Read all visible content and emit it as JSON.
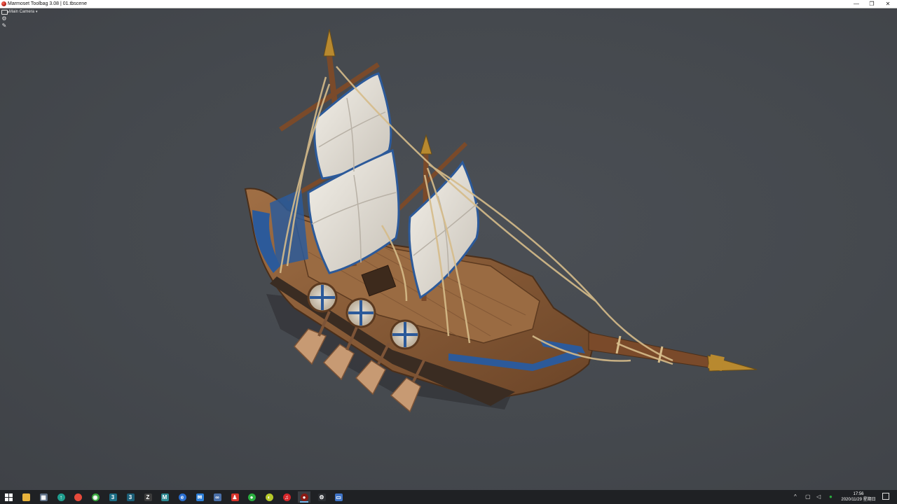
{
  "window": {
    "title": "Marmoset Toolbag 3.08 | 01.tbscene",
    "minimize_glyph": "—",
    "restore_glyph": "❐",
    "close_glyph": "✕"
  },
  "viewport": {
    "camera_label": "Main Camera",
    "camera_caret": "▾",
    "settings_glyph": "⚙",
    "light_glyph": "✎",
    "background_color": "#45494e"
  },
  "taskbar": {
    "start_icon": "windows-icon",
    "apps": [
      {
        "name": "file-explorer-icon",
        "glyph": "",
        "color": "#e8b33c"
      },
      {
        "name": "calculator-icon",
        "glyph": "▦",
        "color": "#5d6f86"
      },
      {
        "name": "app-circle-icon",
        "glyph": "↑",
        "color": "#1f9e8f"
      },
      {
        "name": "chrome-icon",
        "glyph": "",
        "color": "#e64a3b"
      },
      {
        "name": "green-app-icon",
        "glyph": "◉",
        "color": "#3aa83f"
      },
      {
        "name": "3dsmax-icon",
        "glyph": "3",
        "color": "#1d6f87"
      },
      {
        "name": "3dsmax-alt-icon",
        "glyph": "3",
        "color": "#1b5f78"
      },
      {
        "name": "zbrush-icon",
        "glyph": "Z",
        "color": "#3c3c3c"
      },
      {
        "name": "maya-icon",
        "glyph": "M",
        "color": "#2d8a93"
      },
      {
        "name": "browser-blue-icon",
        "glyph": "e",
        "color": "#2a6fd0"
      },
      {
        "name": "messenger-icon",
        "glyph": "✉",
        "color": "#2d7fd8"
      },
      {
        "name": "connection-icon",
        "glyph": "∞",
        "color": "#4a6fa8"
      },
      {
        "name": "qq-icon",
        "glyph": "♟",
        "color": "#d8342b"
      },
      {
        "name": "wechat-icon",
        "glyph": "●",
        "color": "#2aae3f"
      },
      {
        "name": "yellow-app-icon",
        "glyph": "◐",
        "color": "#b6c92a"
      },
      {
        "name": "netease-music-icon",
        "glyph": "♫",
        "color": "#d6262a"
      },
      {
        "name": "marmoset-icon",
        "glyph": "●",
        "color": "#8a1a14"
      },
      {
        "name": "settings-icon",
        "glyph": "⚙",
        "color": "#2c2f33"
      },
      {
        "name": "remote-desktop-icon",
        "glyph": "▭",
        "color": "#3f74c7"
      }
    ],
    "tray": {
      "chevron": "^",
      "network_glyph": "▢",
      "volume_glyph": "◁",
      "wechat_glyph": "●",
      "ime_glyph": "⚲",
      "time": "17:56",
      "date": "2020/11/29 星期日"
    }
  }
}
